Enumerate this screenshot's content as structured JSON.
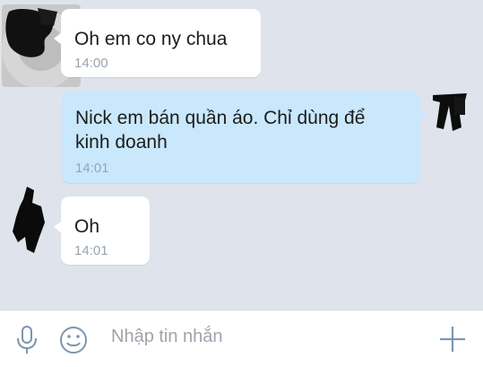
{
  "messages": [
    {
      "direction": "incoming",
      "text": "Oh em co ny chua",
      "time": "14:00"
    },
    {
      "direction": "outgoing",
      "line1": "Nick em bán quần áo. Chỉ dùng để",
      "line2": "kinh doanh",
      "time": "14:01"
    },
    {
      "direction": "incoming",
      "text": "Oh",
      "time": "14:01"
    }
  ],
  "composer": {
    "placeholder": "Nhập tin nhắn",
    "mic_icon": "microphone-icon",
    "emoji_icon": "smiley-icon",
    "add_icon": "plus-icon"
  },
  "colors": {
    "background": "#dfe4ec",
    "incoming_bubble": "#ffffff",
    "outgoing_bubble": "#c9e8fb",
    "timestamp": "#9aa3ad",
    "icon": "#7d95b0"
  }
}
